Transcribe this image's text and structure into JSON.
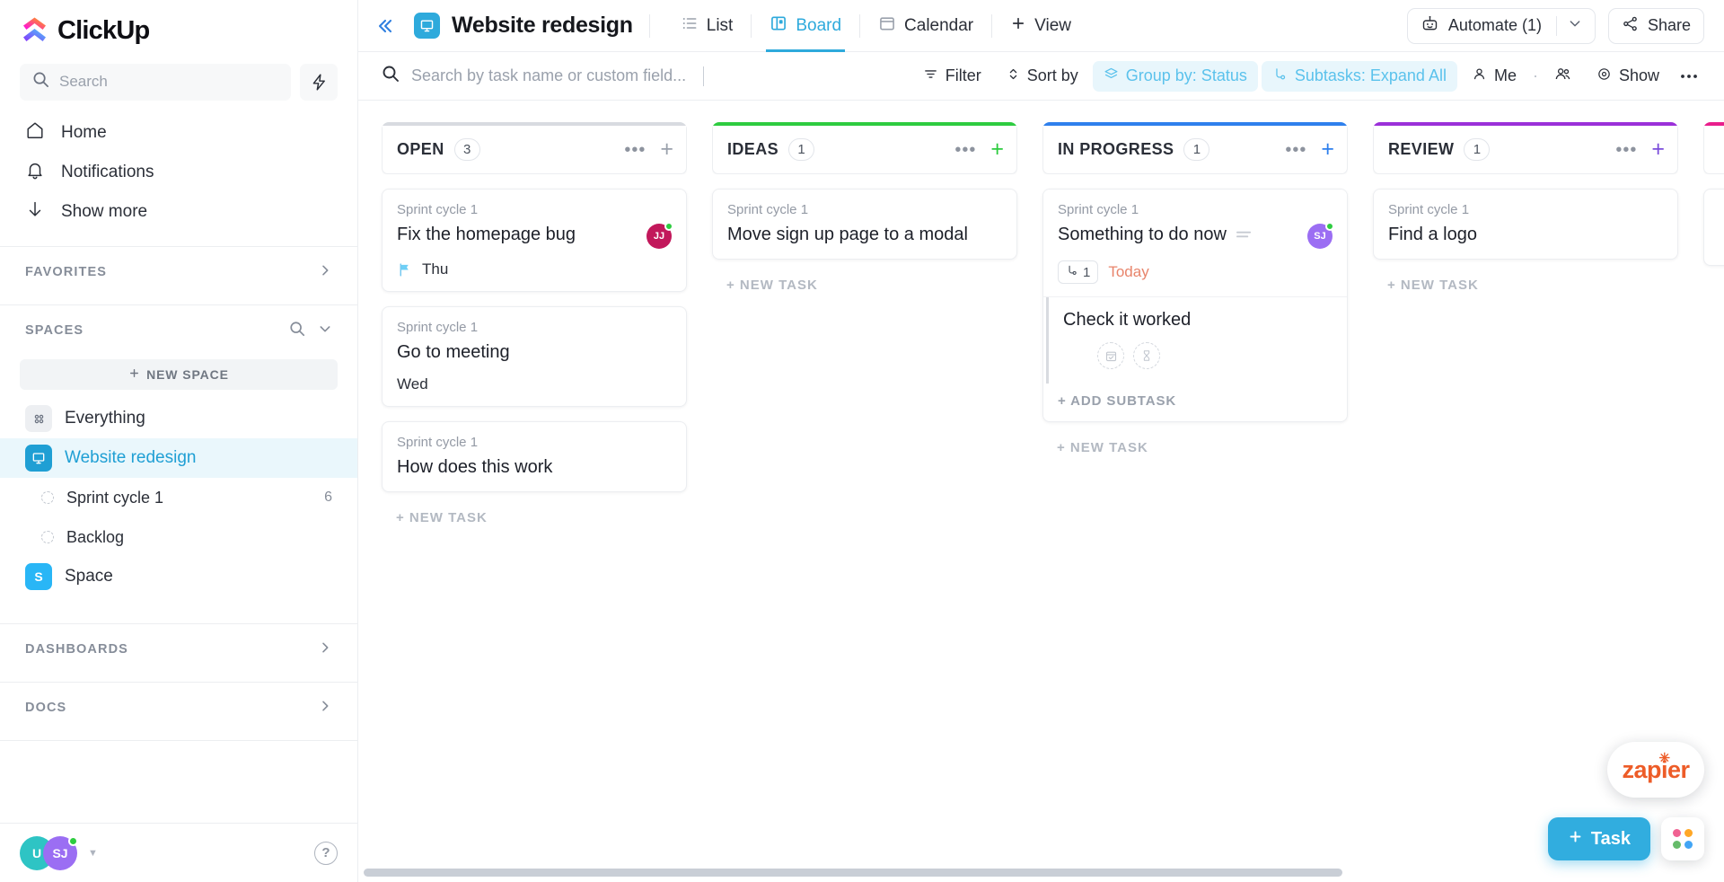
{
  "brand": {
    "name": "ClickUp",
    "accent": "#2eaadc",
    "logo_icon": "clickup-logo-icon"
  },
  "sidebar": {
    "search": {
      "placeholder": "Search",
      "icon": "search-icon"
    },
    "bolt_icon": "lightning-bolt-icon",
    "nav": [
      {
        "label": "Home",
        "icon": "home-icon"
      },
      {
        "label": "Notifications",
        "icon": "bell-icon"
      },
      {
        "label": "Show more",
        "icon": "arrow-down-icon"
      }
    ],
    "sections": [
      {
        "label": "FAVORITES",
        "chevron": "chevron-right-icon"
      },
      {
        "label": "SPACES",
        "search_icon": "search-icon",
        "chevron": "chevron-down-icon"
      },
      {
        "label": "DASHBOARDS",
        "chevron": "chevron-right-icon"
      },
      {
        "label": "DOCS",
        "chevron": "chevron-right-icon"
      }
    ],
    "new_space_label": "NEW SPACE",
    "spaces": [
      {
        "label": "Everything",
        "icon": "grid-icon",
        "icon_bg": "#edeff2",
        "icon_color": "#6b7280",
        "active": false
      },
      {
        "label": "Website redesign",
        "icon": "monitor-icon",
        "icon_bg": "#1f9fd4",
        "icon_color": "#ffffff",
        "active": true
      }
    ],
    "lists": [
      {
        "label": "Sprint cycle 1",
        "count": "6"
      },
      {
        "label": "Backlog",
        "count": ""
      }
    ],
    "space_bottom": {
      "label": "Space",
      "initial": "S",
      "icon_bg": "#29b6f6"
    },
    "footer": {
      "avatars": [
        {
          "initials": "U",
          "color": "#2ec4c4",
          "online": false
        },
        {
          "initials": "SJ",
          "color": "#9b6ef3",
          "online": true
        }
      ],
      "caret_icon": "caret-down-icon",
      "help_label": "?"
    }
  },
  "header": {
    "collapse_icon": "collapse-sidebar-icon",
    "title": "Website redesign",
    "title_icon": "monitor-icon",
    "tabs": [
      {
        "label": "List",
        "icon": "list-icon",
        "active": false
      },
      {
        "label": "Board",
        "icon": "board-icon",
        "active": true
      },
      {
        "label": "Calendar",
        "icon": "calendar-icon",
        "active": false
      }
    ],
    "add_view": {
      "label": "View",
      "icon": "plus-icon"
    },
    "automate": {
      "label": "Automate (1)",
      "icon": "robot-icon",
      "chevron": "chevron-down-icon"
    },
    "share": {
      "label": "Share",
      "icon": "share-icon"
    }
  },
  "toolbar": {
    "search_placeholder": "Search by task name or custom field...",
    "search_icon": "search-icon",
    "buttons": [
      {
        "label": "Filter",
        "icon": "filter-icon",
        "highlighted": false
      },
      {
        "label": "Sort by",
        "icon": "sort-icon",
        "highlighted": false
      },
      {
        "label": "Group by: Status",
        "icon": "layers-icon",
        "highlighted": true
      },
      {
        "label": "Subtasks: Expand All",
        "icon": "subtask-icon",
        "highlighted": true
      }
    ],
    "me_label": "Me",
    "me_icon": "person-icon",
    "assignees_icon": "people-icon",
    "show_label": "Show",
    "show_icon": "eye-icon",
    "more_icon": "more-horizontal-icon"
  },
  "board": {
    "new_task_label": "+ NEW TASK",
    "add_subtask_label": "+ ADD SUBTASK",
    "columns": [
      {
        "name": "OPEN",
        "count": "3",
        "color": "#d8dbe0",
        "plus_color": "#9aa1ac",
        "cards": [
          {
            "list": "Sprint cycle 1",
            "title": "Fix the homepage bug",
            "avatar": {
              "initials": "JJ",
              "color": "#c2185b",
              "online": true
            },
            "meta_type": "flag",
            "meta_text": "Thu"
          },
          {
            "list": "Sprint cycle 1",
            "title": "Go to meeting",
            "meta_type": "plain",
            "meta_text": "Wed"
          },
          {
            "list": "Sprint cycle 1",
            "title": "How does this work",
            "meta_type": "none",
            "meta_text": ""
          }
        ]
      },
      {
        "name": "IDEAS",
        "count": "1",
        "color": "#2ecc40",
        "plus_color": "#2ecc40",
        "cards": [
          {
            "list": "Sprint cycle 1",
            "title": "Move sign up page to a modal",
            "meta_type": "none",
            "meta_text": ""
          }
        ]
      },
      {
        "name": "IN PROGRESS",
        "count": "1",
        "color": "#2f80ed",
        "plus_color": "#2f80ed",
        "cards": [
          {
            "list": "Sprint cycle 1",
            "title": "Something to do now",
            "has_priority_bars": true,
            "avatar": {
              "initials": "SJ",
              "color": "#9b6ef3",
              "online": true
            },
            "meta_type": "subtask-badge",
            "subtask_count": "1",
            "due_label": "Today",
            "subtask": {
              "title": "Check it worked",
              "placeholders": [
                "calendar-check-icon",
                "hourglass-icon"
              ]
            }
          }
        ]
      },
      {
        "name": "REVIEW",
        "count": "1",
        "color": "#9b30d9",
        "plus_color": "#7b4ddb",
        "cards": [
          {
            "list": "Sprint cycle 1",
            "title": "Find a logo",
            "meta_type": "none",
            "meta_text": ""
          }
        ]
      },
      {
        "name": "",
        "count": "",
        "color": "#e91e8c",
        "plus_color": "#e91e8c",
        "cards": []
      }
    ]
  },
  "widgets": {
    "zapier_label": "zapier",
    "fab_task_label": "Task",
    "fab_task_icon": "plus-icon",
    "apps_icon": "apps-grid-icon",
    "cursor_icon": "grab-hand-cursor"
  }
}
